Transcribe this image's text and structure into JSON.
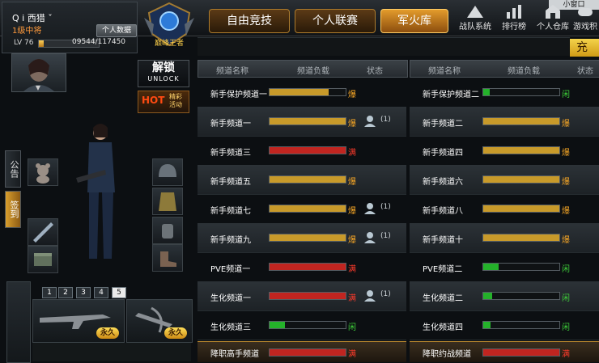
{
  "mini_window": "小窗口",
  "profile": {
    "nickname": "Q i 西猎 ˇ",
    "rank": "1级中将",
    "data_button": "个人数据",
    "level": "LV 76",
    "exp": "09544/117450",
    "exp_fraction": 0.08
  },
  "tabs": [
    {
      "label": "自由竞技",
      "active": false
    },
    {
      "label": "个人联赛",
      "active": false
    },
    {
      "label": "军火库",
      "active": true
    }
  ],
  "system": [
    {
      "label": "战队系统",
      "icon": "team-icon"
    },
    {
      "label": "排行榜",
      "icon": "ranking-icon"
    },
    {
      "label": "个人仓库",
      "icon": "warehouse-icon"
    },
    {
      "label": "游戏积",
      "icon": "game-icon"
    }
  ],
  "recharge": "充",
  "emblem_text": "巅峰王者",
  "unlock": {
    "main": "解锁",
    "sub": "UNLOCK"
  },
  "hot": {
    "tag": "HOT",
    "text1": "精彩",
    "text2": "活动"
  },
  "side_tabs": [
    "公告",
    "签到"
  ],
  "weapon_tabs": [
    "1",
    "2",
    "3",
    "4",
    "5"
  ],
  "weapon_cards": [
    {
      "perm": "永久"
    },
    {
      "perm": "永久"
    }
  ],
  "colors": {
    "bar_orange": "#c89a2a",
    "bar_red": "#c12520",
    "bar_green": "#24b22a",
    "status_orange": "#f4a526",
    "status_red": "#ff3b2b",
    "status_green": "#3fd13a"
  },
  "headers": {
    "name": "频道名称",
    "load": "频道负载",
    "status": "状态"
  },
  "channels_left": [
    {
      "name": "新手保护频道一",
      "load": 0.78,
      "color": "orange",
      "status": "爆",
      "friends": ""
    },
    {
      "name": "新手频道一",
      "load": 1.0,
      "color": "orange",
      "status": "爆",
      "friends": "(1)"
    },
    {
      "name": "新手频道三",
      "load": 1.0,
      "color": "red",
      "status": "满",
      "friends": ""
    },
    {
      "name": "新手频道五",
      "load": 1.0,
      "color": "orange",
      "status": "爆",
      "friends": ""
    },
    {
      "name": "新手频道七",
      "load": 1.0,
      "color": "orange",
      "status": "爆",
      "friends": "(1)"
    },
    {
      "name": "新手频道九",
      "load": 1.0,
      "color": "orange",
      "status": "爆",
      "friends": "(1)"
    },
    {
      "name": "PVE频道一",
      "load": 1.0,
      "color": "red",
      "status": "满",
      "friends": ""
    },
    {
      "name": "生化频道一",
      "load": 1.0,
      "color": "red",
      "status": "满",
      "friends": "(1)"
    },
    {
      "name": "生化频道三",
      "load": 0.2,
      "color": "green",
      "status": "闲",
      "friends": ""
    }
  ],
  "channels_right": [
    {
      "name": "新手保护频道二",
      "load": 0.08,
      "color": "green",
      "status": "闲",
      "friends": ""
    },
    {
      "name": "新手频道二",
      "load": 1.0,
      "color": "orange",
      "status": "爆",
      "friends": ""
    },
    {
      "name": "新手频道四",
      "load": 1.0,
      "color": "orange",
      "status": "爆",
      "friends": ""
    },
    {
      "name": "新手频道六",
      "load": 1.0,
      "color": "orange",
      "status": "爆",
      "friends": ""
    },
    {
      "name": "新手频道八",
      "load": 1.0,
      "color": "orange",
      "status": "爆",
      "friends": ""
    },
    {
      "name": "新手频道十",
      "load": 1.0,
      "color": "orange",
      "status": "爆",
      "friends": ""
    },
    {
      "name": "PVE频道二",
      "load": 0.2,
      "color": "green",
      "status": "闲",
      "friends": ""
    },
    {
      "name": "生化频道二",
      "load": 0.12,
      "color": "green",
      "status": "闲",
      "friends": ""
    },
    {
      "name": "生化频道四",
      "load": 0.1,
      "color": "green",
      "status": "闲",
      "friends": ""
    }
  ],
  "footer_left": {
    "name": "降职高手频道",
    "status": "满"
  },
  "footer_right": {
    "name": "降职约战频道",
    "status": "满"
  }
}
